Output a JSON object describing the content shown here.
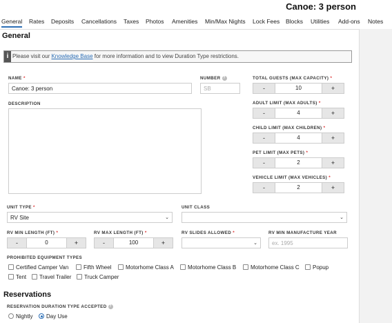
{
  "header": {
    "title": "Canoe: 3 person"
  },
  "tabs": [
    "General",
    "Rates",
    "Deposits",
    "Cancellations",
    "Taxes",
    "Photos",
    "Amenities",
    "Min/Max Nights",
    "Lock Fees",
    "Blocks",
    "Utilities",
    "Add-ons",
    "Notes"
  ],
  "general": {
    "heading": "General",
    "notice": {
      "icon": "i",
      "prefix": "Please visit our ",
      "link": "Knowledge Base",
      "suffix": " for more information and to view Duration Type restrictions."
    },
    "name": {
      "label": "NAME",
      "req": "*",
      "value": "Canoe: 3 person"
    },
    "number": {
      "label": "NUMBER",
      "placeholder": "SB"
    },
    "description": {
      "label": "DESCRIPTION"
    },
    "total_guests": {
      "label": "TOTAL GUESTS (MAX CAPACITY)",
      "req": "*",
      "value": "10"
    },
    "adult_limit": {
      "label": "ADULT LIMIT (MAX ADULTS)",
      "req": "*",
      "value": "4"
    },
    "child_limit": {
      "label": "CHILD LIMIT (MAX CHILDREN)",
      "req": "*",
      "value": "4"
    },
    "pet_limit": {
      "label": "PET LIMIT (MAX PETS)",
      "req": "*",
      "value": "2"
    },
    "vehicle_limit": {
      "label": "VEHICLE LIMIT (MAX VEHICLES)",
      "req": "*",
      "value": "2"
    },
    "unit_type": {
      "label": "UNIT TYPE",
      "req": "*",
      "value": "RV Site"
    },
    "unit_class": {
      "label": "UNIT CLASS",
      "value": ""
    },
    "rv_min_length": {
      "label": "RV MIN LENGTH (FT)",
      "req": "*",
      "value": "0"
    },
    "rv_max_length": {
      "label": "RV MAX LENGTH (FT)",
      "req": "*",
      "value": "100"
    },
    "rv_slides": {
      "label": "RV SLIDES ALLOWED",
      "req": "*",
      "value": ""
    },
    "rv_min_year": {
      "label": "RV MIN MANUFACTURE YEAR",
      "placeholder": "ex. 1995"
    },
    "stepper": {
      "minus": "-",
      "plus": "+"
    },
    "prohibited": {
      "label": "PROHIBITED EQUIPMENT TYPES",
      "items": [
        "Certified Camper Van",
        "Fifth Wheel",
        "Motorhome Class A",
        "Motorhome Class B",
        "Motorhome Class C",
        "Popup",
        "Tent",
        "Travel Trailer",
        "Truck Camper"
      ]
    }
  },
  "reservations": {
    "heading": "Reservations",
    "duration_label": "RESERVATION DURATION TYPE ACCEPTED",
    "options": [
      "Nightly",
      "Day Use"
    ],
    "selected": "Day Use"
  }
}
